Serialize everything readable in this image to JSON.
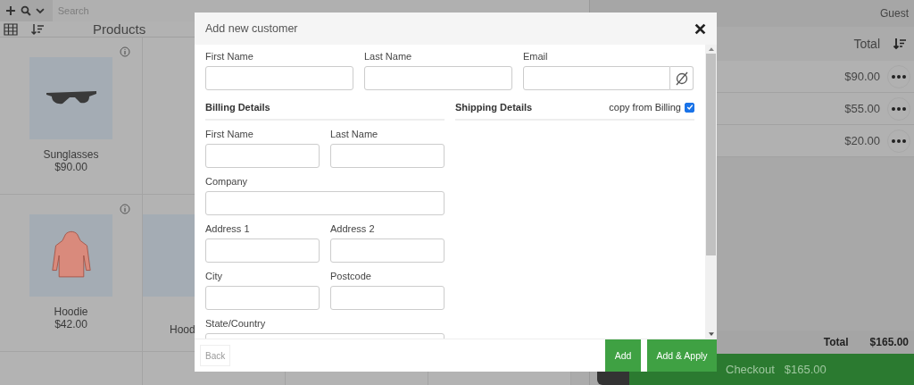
{
  "toolbar": {
    "search": {
      "placeholder": "Search"
    },
    "user": "Guest"
  },
  "products": {
    "header": "Products",
    "rows": [
      {
        "items": [
          {
            "name": "Sunglasses",
            "price": "$90.00"
          }
        ]
      },
      {
        "items": [
          {
            "name": "Hoodie",
            "price": "$42.00"
          },
          {
            "name": "Hood"
          }
        ]
      }
    ]
  },
  "cart": {
    "header": "Total",
    "prices": [
      "$90.00",
      "$55.00",
      "$20.00"
    ],
    "total_label": "Total",
    "total": "$165.00",
    "checkout_label": "Checkout",
    "checkout_total": "$165.00"
  },
  "dialog": {
    "title": "Add new customer",
    "fields": [
      {
        "label": "First Name"
      },
      {
        "label": "Last Name"
      },
      {
        "label": "Email"
      }
    ],
    "billing": {
      "title": "Billing Details",
      "fields": [
        {
          "label": "First Name",
          "kind": "half"
        },
        {
          "label": "Last Name",
          "kind": "half"
        },
        {
          "label": "Company",
          "kind": "wide"
        },
        {
          "label": "Address 1",
          "kind": "half"
        },
        {
          "label": "Address 2",
          "kind": "half"
        },
        {
          "label": "City",
          "kind": "half"
        },
        {
          "label": "Postcode",
          "kind": "half"
        },
        {
          "label": "State/Country",
          "kind": "wide"
        }
      ]
    },
    "shipping": {
      "title": "Shipping Details",
      "copy_label": "copy from Billing",
      "copy_checked": true
    },
    "buttons": {
      "back": "Back",
      "add": "Add",
      "add_apply": "Add & Apply"
    }
  }
}
